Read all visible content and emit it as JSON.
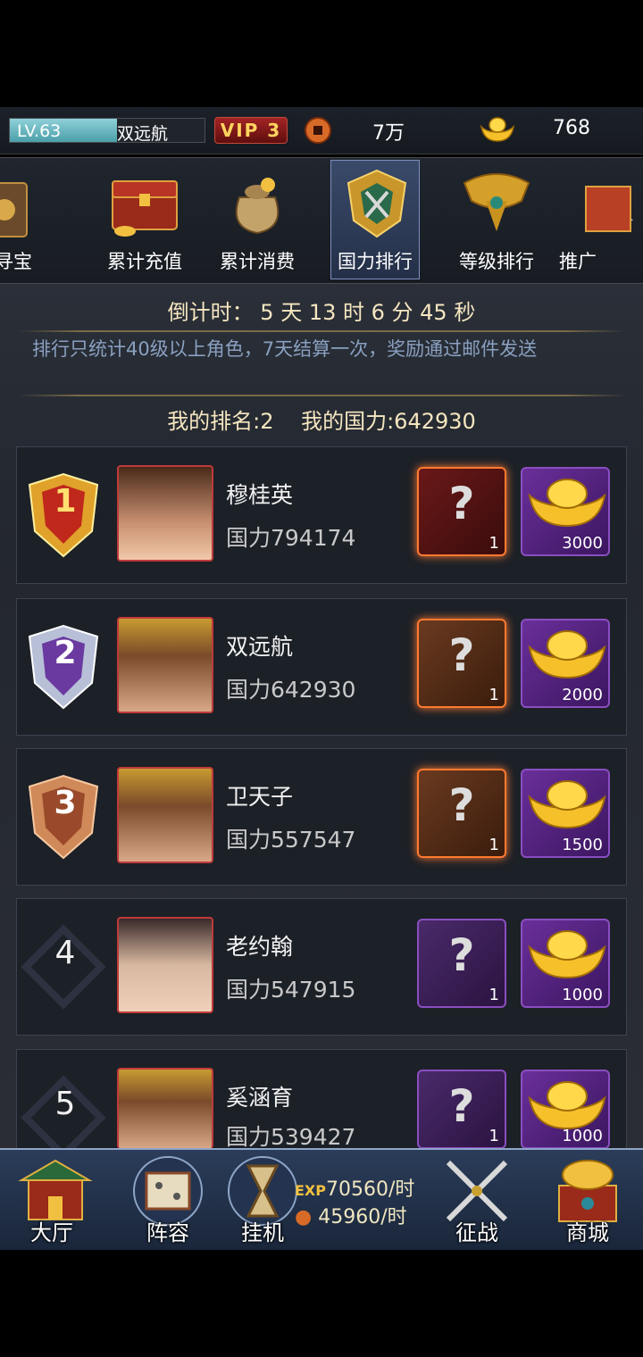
{
  "status_bar": {
    "level": "LV.63",
    "level_progress": 0.55,
    "player_name": "双远航",
    "vip": "VIP 3",
    "copper": "7万",
    "gold": "768"
  },
  "tabs": [
    {
      "label": "寻宝",
      "icon": "treasure-icon"
    },
    {
      "label": "累计充值",
      "icon": "chest-icon"
    },
    {
      "label": "累计消费",
      "icon": "money-bag-icon"
    },
    {
      "label": "国力排行",
      "icon": "crest-icon",
      "selected": true
    },
    {
      "label": "等级排行",
      "icon": "helmet-icon"
    },
    {
      "label": "推广",
      "icon": "gift-icon"
    }
  ],
  "info": {
    "countdown": "倒计时：  5  天 13 时  6  分 45 秒",
    "notice": "排行只统计40级以上角色，7天结算一次，奖励通过邮件发送",
    "my_rank_label": "我的排名:",
    "my_rank": "2",
    "my_power_label": "我的国力:",
    "my_power": "642930"
  },
  "rankings": [
    {
      "rank": "1",
      "name": "穆桂英",
      "power": "国力794174",
      "box_count": "1",
      "box_tier": "red",
      "gold": "3000"
    },
    {
      "rank": "2",
      "name": "双远航",
      "power": "国力642930",
      "box_count": "1",
      "box_tier": "orange",
      "gold": "2000"
    },
    {
      "rank": "3",
      "name": "卫天子",
      "power": "国力557547",
      "box_count": "1",
      "box_tier": "orange",
      "gold": "1500"
    },
    {
      "rank": "4",
      "name": "老约翰",
      "power": "国力547915",
      "box_count": "1",
      "box_tier": "purple",
      "gold": "1000"
    },
    {
      "rank": "5",
      "name": "奚涵育",
      "power": "国力539427",
      "box_count": "1",
      "box_tier": "purple",
      "gold": "1000"
    }
  ],
  "nav": {
    "hall": "大厅",
    "lineup": "阵容",
    "idle": "挂机",
    "exp_rate": "70560/时",
    "copper_rate": "45960/时",
    "exp_label": "EXP",
    "campaign": "征战",
    "shop": "商城"
  }
}
